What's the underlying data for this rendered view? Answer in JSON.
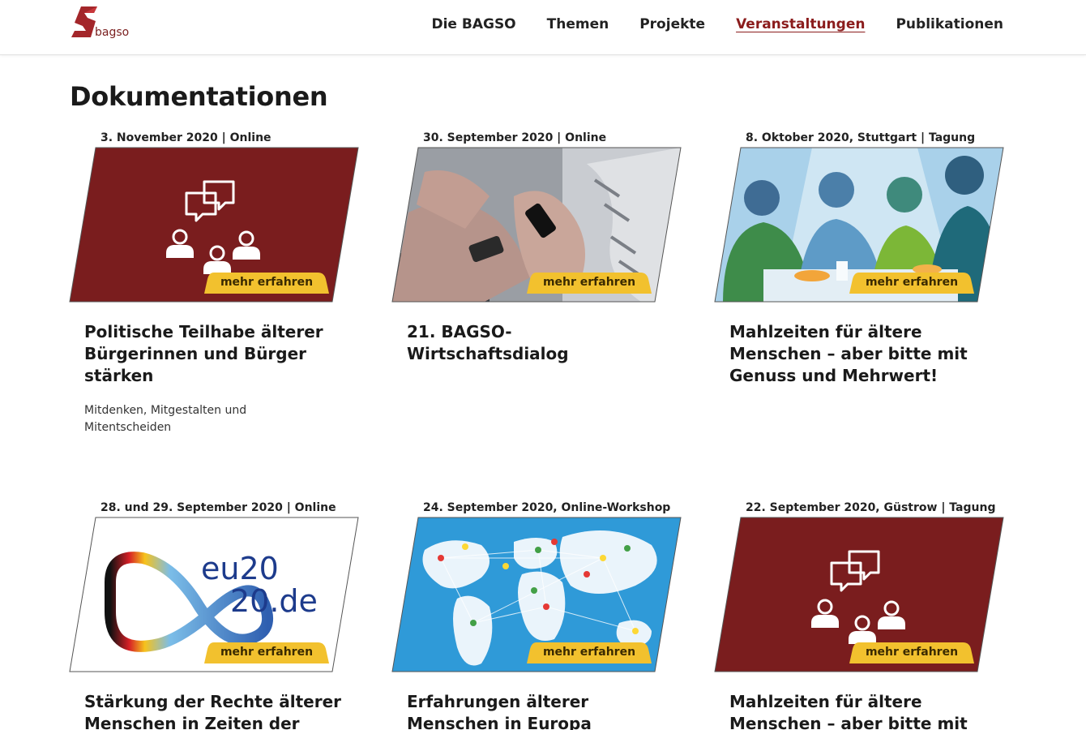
{
  "brand": {
    "name": "bagso",
    "primary": "#8b1c1c",
    "accent": "#f2c12e"
  },
  "nav": {
    "items": [
      {
        "label": "Die BAGSO"
      },
      {
        "label": "Themen"
      },
      {
        "label": "Projekte"
      },
      {
        "label": "Veranstaltungen",
        "active": true
      },
      {
        "label": "Publikationen"
      }
    ]
  },
  "page": {
    "title": "Dokumentationen"
  },
  "cards": [
    {
      "meta": "3. November 2020 | Online",
      "image": "red-people-chat-icon",
      "cta": "mehr erfahren",
      "title": "Politische Teilhabe älterer Bürgerinnen und Bürger stärken",
      "subtitle": "Mitdenken, Mitgestalten und Mitentscheiden"
    },
    {
      "meta": "30. September 2020 | Online",
      "image": "photo-hands-smartphone",
      "cta": "mehr erfahren",
      "title": "21. BAGSO-Wirtschaftsdialog",
      "subtitle": ""
    },
    {
      "meta": "8. Oktober 2020, Stuttgart | Tagung",
      "image": "illustration-people-eating",
      "cta": "mehr erfahren",
      "title": "Mahlzeiten für ältere Menschen – aber bitte mit Genuss und Mehrwert!",
      "subtitle": ""
    },
    {
      "meta": "28. und 29. September 2020 | Online",
      "image": "eu2020-logo",
      "image_text_1": "eu20",
      "image_text_2": "20.de",
      "cta": "mehr erfahren",
      "title": "Stärkung der Rechte älterer Menschen in Zeiten der",
      "subtitle": ""
    },
    {
      "meta": "24. September 2020, Online-Workshop",
      "image": "world-map-network",
      "cta": "mehr erfahren",
      "title": "Erfahrungen älterer Menschen in Europa",
      "subtitle": ""
    },
    {
      "meta": "22. September 2020, Güstrow | Tagung",
      "image": "red-people-chat-icon",
      "cta": "mehr erfahren",
      "title": "Mahlzeiten für ältere Menschen – aber bitte mit",
      "subtitle": ""
    }
  ]
}
